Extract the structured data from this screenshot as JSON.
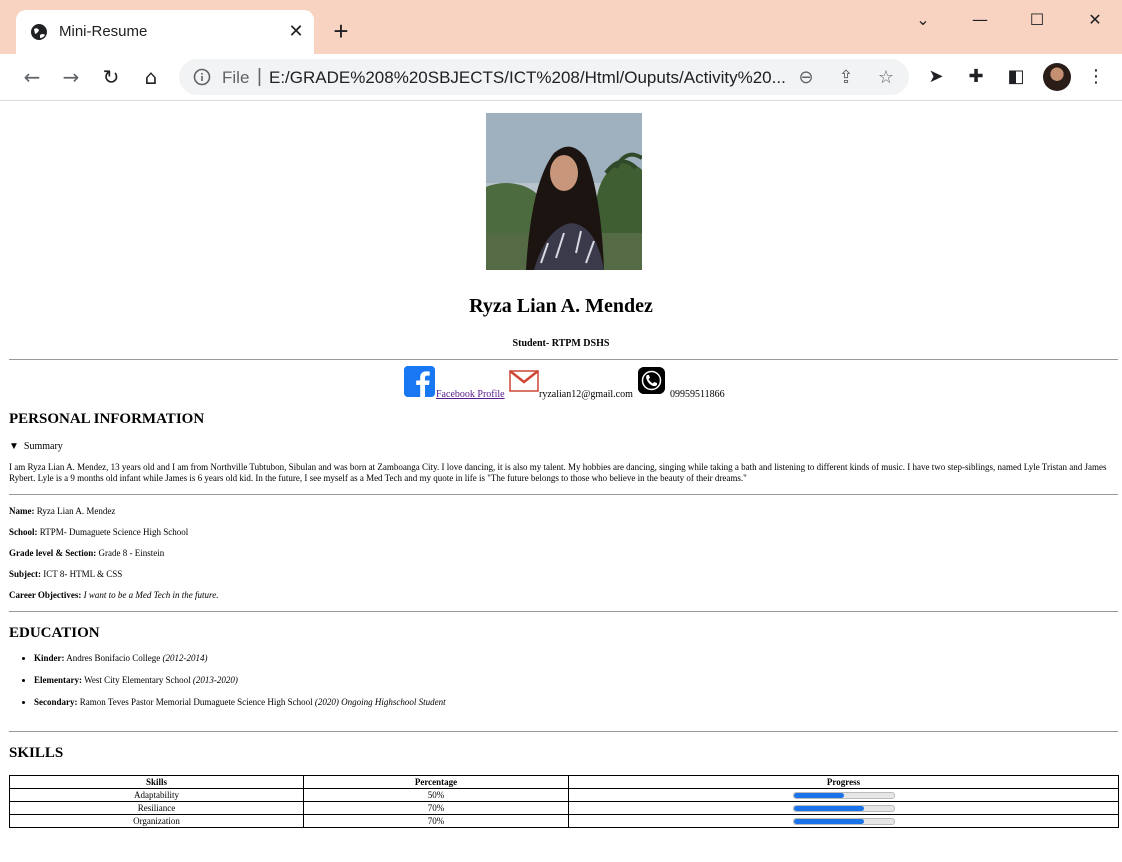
{
  "browser": {
    "tab_title": "Mini-Resume",
    "tab_close": "✕",
    "new_tab": "+",
    "file_label": "File",
    "url": "E:/GRADE%208%20SBJECTS/ICT%208/Html/Ouputs/Activity%20...",
    "window": {
      "minimize": "—",
      "maximize": "☐",
      "close": "✕",
      "menu": "⌄"
    }
  },
  "header": {
    "name": "Ryza Lian A. Mendez",
    "role": "Student- RTPM DSHS"
  },
  "contacts": {
    "facebook": " Facebook Profile ",
    "email": "ryzalian12@gmail.com",
    "phone": " 09959511866"
  },
  "personal": {
    "heading": "PERSONAL INFORMATION",
    "summary_label": "Summary",
    "summary_text": "I am Ryza Lian A. Mendez, 13 years old and I am from Northville Tubtubon, Sibulan and was born at Zamboanga City. I love dancing, it is also my talent. My hobbies are dancing, singing while taking a bath and listening to different kinds of music. I have two step-siblings, named Lyle Tristan and James Rybert. Lyle is a 9 months old infant while James is 6 years old kid. In the future, I see myself as a Med Tech and my quote in life is \"The future belongs to those who believe in the beauty of their dreams.\"",
    "fields": [
      {
        "label": "Name:",
        "value": " Ryza Lian A. Mendez"
      },
      {
        "label": "School:",
        "value": " RTPM- Dumaguete Science High School"
      },
      {
        "label": "Grade level & Section:",
        "value": " Grade 8 - Einstein"
      },
      {
        "label": "Subject:",
        "value": " ICT 8- HTML & CSS"
      },
      {
        "label": "Career Objectives:",
        "value": "I want to be a Med Tech in the future."
      }
    ]
  },
  "education": {
    "heading": "EDUCATION",
    "items": [
      {
        "label": "Kinder:",
        "school": " Andres Bonifacio College ",
        "years": "(2012-2014)"
      },
      {
        "label": "Elementary:",
        "school": " West City Elementary School ",
        "years": "(2013-2020)"
      },
      {
        "label": "Secondary:",
        "school": " Ramon Teves Pastor Memorial Dumaguete Science High School ",
        "years": "(2020) Ongoing Highschool Student"
      }
    ]
  },
  "skills": {
    "heading": "SKILLS",
    "columns": [
      "Skills",
      "Percentage",
      "Progress"
    ],
    "rows": [
      {
        "skill": "Adaptability",
        "percentage": "50%",
        "progress": 0.5
      },
      {
        "skill": "Resiliance",
        "percentage": "70%",
        "progress": 0.7
      },
      {
        "skill": "Organization",
        "percentage": "70%",
        "progress": 0.7
      }
    ]
  },
  "colors": {
    "titlebar": "#f9d3c2",
    "progress": "#1a73e8",
    "link": "#551a8b"
  }
}
